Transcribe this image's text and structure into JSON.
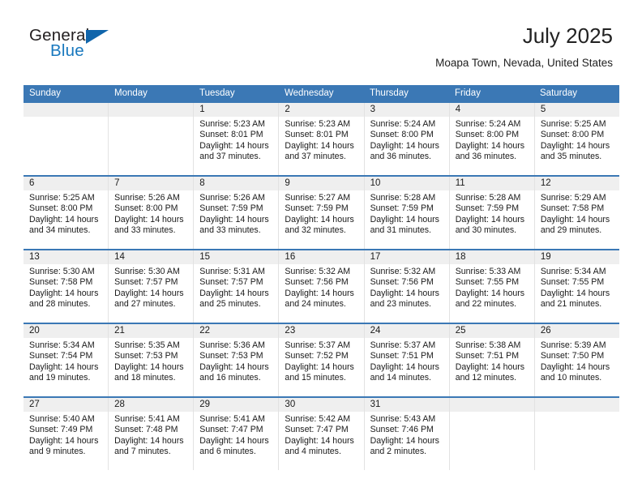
{
  "brand": {
    "name_top": "General",
    "name_bottom": "Blue",
    "triangle_color": "#1065ab",
    "blue_text_color": "#1878be"
  },
  "header": {
    "title": "July 2025",
    "subtitle": "Moapa Town, Nevada, United States",
    "header_bg_color": "#3b78b5",
    "number_row_bg_color": "#efefef"
  },
  "calendar": {
    "day_headers": [
      "Sunday",
      "Monday",
      "Tuesday",
      "Wednesday",
      "Thursday",
      "Friday",
      "Saturday"
    ],
    "weeks": [
      {
        "days": [
          {
            "date": "",
            "sunrise": "",
            "sunset": "",
            "daylight_line1": "",
            "daylight_line2": ""
          },
          {
            "date": "",
            "sunrise": "",
            "sunset": "",
            "daylight_line1": "",
            "daylight_line2": ""
          },
          {
            "date": "1",
            "sunrise": "Sunrise: 5:23 AM",
            "sunset": "Sunset: 8:01 PM",
            "daylight_line1": "Daylight: 14 hours",
            "daylight_line2": "and 37 minutes."
          },
          {
            "date": "2",
            "sunrise": "Sunrise: 5:23 AM",
            "sunset": "Sunset: 8:01 PM",
            "daylight_line1": "Daylight: 14 hours",
            "daylight_line2": "and 37 minutes."
          },
          {
            "date": "3",
            "sunrise": "Sunrise: 5:24 AM",
            "sunset": "Sunset: 8:00 PM",
            "daylight_line1": "Daylight: 14 hours",
            "daylight_line2": "and 36 minutes."
          },
          {
            "date": "4",
            "sunrise": "Sunrise: 5:24 AM",
            "sunset": "Sunset: 8:00 PM",
            "daylight_line1": "Daylight: 14 hours",
            "daylight_line2": "and 36 minutes."
          },
          {
            "date": "5",
            "sunrise": "Sunrise: 5:25 AM",
            "sunset": "Sunset: 8:00 PM",
            "daylight_line1": "Daylight: 14 hours",
            "daylight_line2": "and 35 minutes."
          }
        ]
      },
      {
        "days": [
          {
            "date": "6",
            "sunrise": "Sunrise: 5:25 AM",
            "sunset": "Sunset: 8:00 PM",
            "daylight_line1": "Daylight: 14 hours",
            "daylight_line2": "and 34 minutes."
          },
          {
            "date": "7",
            "sunrise": "Sunrise: 5:26 AM",
            "sunset": "Sunset: 8:00 PM",
            "daylight_line1": "Daylight: 14 hours",
            "daylight_line2": "and 33 minutes."
          },
          {
            "date": "8",
            "sunrise": "Sunrise: 5:26 AM",
            "sunset": "Sunset: 7:59 PM",
            "daylight_line1": "Daylight: 14 hours",
            "daylight_line2": "and 33 minutes."
          },
          {
            "date": "9",
            "sunrise": "Sunrise: 5:27 AM",
            "sunset": "Sunset: 7:59 PM",
            "daylight_line1": "Daylight: 14 hours",
            "daylight_line2": "and 32 minutes."
          },
          {
            "date": "10",
            "sunrise": "Sunrise: 5:28 AM",
            "sunset": "Sunset: 7:59 PM",
            "daylight_line1": "Daylight: 14 hours",
            "daylight_line2": "and 31 minutes."
          },
          {
            "date": "11",
            "sunrise": "Sunrise: 5:28 AM",
            "sunset": "Sunset: 7:59 PM",
            "daylight_line1": "Daylight: 14 hours",
            "daylight_line2": "and 30 minutes."
          },
          {
            "date": "12",
            "sunrise": "Sunrise: 5:29 AM",
            "sunset": "Sunset: 7:58 PM",
            "daylight_line1": "Daylight: 14 hours",
            "daylight_line2": "and 29 minutes."
          }
        ]
      },
      {
        "days": [
          {
            "date": "13",
            "sunrise": "Sunrise: 5:30 AM",
            "sunset": "Sunset: 7:58 PM",
            "daylight_line1": "Daylight: 14 hours",
            "daylight_line2": "and 28 minutes."
          },
          {
            "date": "14",
            "sunrise": "Sunrise: 5:30 AM",
            "sunset": "Sunset: 7:57 PM",
            "daylight_line1": "Daylight: 14 hours",
            "daylight_line2": "and 27 minutes."
          },
          {
            "date": "15",
            "sunrise": "Sunrise: 5:31 AM",
            "sunset": "Sunset: 7:57 PM",
            "daylight_line1": "Daylight: 14 hours",
            "daylight_line2": "and 25 minutes."
          },
          {
            "date": "16",
            "sunrise": "Sunrise: 5:32 AM",
            "sunset": "Sunset: 7:56 PM",
            "daylight_line1": "Daylight: 14 hours",
            "daylight_line2": "and 24 minutes."
          },
          {
            "date": "17",
            "sunrise": "Sunrise: 5:32 AM",
            "sunset": "Sunset: 7:56 PM",
            "daylight_line1": "Daylight: 14 hours",
            "daylight_line2": "and 23 minutes."
          },
          {
            "date": "18",
            "sunrise": "Sunrise: 5:33 AM",
            "sunset": "Sunset: 7:55 PM",
            "daylight_line1": "Daylight: 14 hours",
            "daylight_line2": "and 22 minutes."
          },
          {
            "date": "19",
            "sunrise": "Sunrise: 5:34 AM",
            "sunset": "Sunset: 7:55 PM",
            "daylight_line1": "Daylight: 14 hours",
            "daylight_line2": "and 21 minutes."
          }
        ]
      },
      {
        "days": [
          {
            "date": "20",
            "sunrise": "Sunrise: 5:34 AM",
            "sunset": "Sunset: 7:54 PM",
            "daylight_line1": "Daylight: 14 hours",
            "daylight_line2": "and 19 minutes."
          },
          {
            "date": "21",
            "sunrise": "Sunrise: 5:35 AM",
            "sunset": "Sunset: 7:53 PM",
            "daylight_line1": "Daylight: 14 hours",
            "daylight_line2": "and 18 minutes."
          },
          {
            "date": "22",
            "sunrise": "Sunrise: 5:36 AM",
            "sunset": "Sunset: 7:53 PM",
            "daylight_line1": "Daylight: 14 hours",
            "daylight_line2": "and 16 minutes."
          },
          {
            "date": "23",
            "sunrise": "Sunrise: 5:37 AM",
            "sunset": "Sunset: 7:52 PM",
            "daylight_line1": "Daylight: 14 hours",
            "daylight_line2": "and 15 minutes."
          },
          {
            "date": "24",
            "sunrise": "Sunrise: 5:37 AM",
            "sunset": "Sunset: 7:51 PM",
            "daylight_line1": "Daylight: 14 hours",
            "daylight_line2": "and 14 minutes."
          },
          {
            "date": "25",
            "sunrise": "Sunrise: 5:38 AM",
            "sunset": "Sunset: 7:51 PM",
            "daylight_line1": "Daylight: 14 hours",
            "daylight_line2": "and 12 minutes."
          },
          {
            "date": "26",
            "sunrise": "Sunrise: 5:39 AM",
            "sunset": "Sunset: 7:50 PM",
            "daylight_line1": "Daylight: 14 hours",
            "daylight_line2": "and 10 minutes."
          }
        ]
      },
      {
        "days": [
          {
            "date": "27",
            "sunrise": "Sunrise: 5:40 AM",
            "sunset": "Sunset: 7:49 PM",
            "daylight_line1": "Daylight: 14 hours",
            "daylight_line2": "and 9 minutes."
          },
          {
            "date": "28",
            "sunrise": "Sunrise: 5:41 AM",
            "sunset": "Sunset: 7:48 PM",
            "daylight_line1": "Daylight: 14 hours",
            "daylight_line2": "and 7 minutes."
          },
          {
            "date": "29",
            "sunrise": "Sunrise: 5:41 AM",
            "sunset": "Sunset: 7:47 PM",
            "daylight_line1": "Daylight: 14 hours",
            "daylight_line2": "and 6 minutes."
          },
          {
            "date": "30",
            "sunrise": "Sunrise: 5:42 AM",
            "sunset": "Sunset: 7:47 PM",
            "daylight_line1": "Daylight: 14 hours",
            "daylight_line2": "and 4 minutes."
          },
          {
            "date": "31",
            "sunrise": "Sunrise: 5:43 AM",
            "sunset": "Sunset: 7:46 PM",
            "daylight_line1": "Daylight: 14 hours",
            "daylight_line2": "and 2 minutes."
          },
          {
            "date": "",
            "sunrise": "",
            "sunset": "",
            "daylight_line1": "",
            "daylight_line2": ""
          },
          {
            "date": "",
            "sunrise": "",
            "sunset": "",
            "daylight_line1": "",
            "daylight_line2": ""
          }
        ]
      }
    ]
  }
}
